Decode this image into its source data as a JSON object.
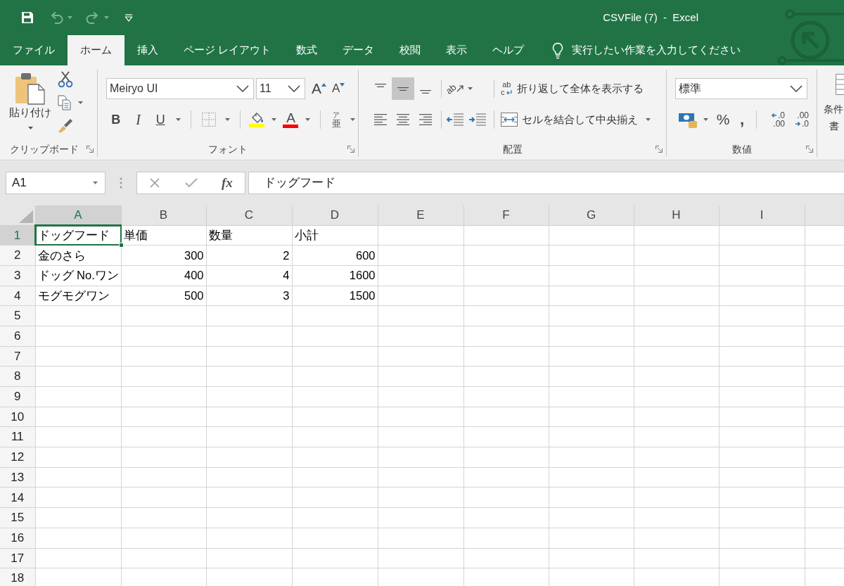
{
  "window": {
    "title": "CSVFile (7)  -  Excel"
  },
  "quick_access": [
    {
      "kind": "save",
      "disabled": false
    },
    {
      "kind": "undo",
      "disabled": true
    },
    {
      "kind": "redo",
      "disabled": true
    },
    {
      "kind": "customize",
      "disabled": false
    }
  ],
  "tabs": [
    {
      "label": "ファイル",
      "selected": false
    },
    {
      "label": "ホーム",
      "selected": true
    },
    {
      "label": "挿入",
      "selected": false
    },
    {
      "label": "ページ レイアウト",
      "selected": false
    },
    {
      "label": "数式",
      "selected": false
    },
    {
      "label": "データ",
      "selected": false
    },
    {
      "label": "校閲",
      "selected": false
    },
    {
      "label": "表示",
      "selected": false
    },
    {
      "label": "ヘルプ",
      "selected": false
    }
  ],
  "tell_me": {
    "placeholder": "実行したい作業を入力してください"
  },
  "ribbon": {
    "clipboard": {
      "label": "クリップボード",
      "paste_label": "貼り付け"
    },
    "font": {
      "label": "フォント",
      "font_name": "Meiryo UI",
      "font_size": "11",
      "grow_glyph": "A",
      "shrink_glyph": "A",
      "styles": [
        {
          "kind": "bold",
          "glyph": "B"
        },
        {
          "kind": "italic",
          "glyph": "I"
        },
        {
          "kind": "underline",
          "glyph": "U"
        }
      ],
      "fill": {
        "color": "#ffff00"
      },
      "font_color": {
        "glyph": "A",
        "color": "#ff0000"
      },
      "phonetic_glyphs": [
        "ア",
        "亜"
      ]
    },
    "alignment": {
      "label": "配置",
      "buttons": [
        {
          "kind": "top",
          "selected": false
        },
        {
          "kind": "middle",
          "selected": true
        },
        {
          "kind": "bottom",
          "selected": false
        },
        {
          "kind": "left",
          "selected": false
        },
        {
          "kind": "center",
          "selected": false
        },
        {
          "kind": "right",
          "selected": false
        }
      ],
      "orientation_glyph": "ab",
      "wrap": {
        "icon_glyphs": [
          "ab",
          "c"
        ],
        "label": "折り返して全体を表示する"
      },
      "merge": {
        "label": "セルを結合して中央揃え"
      }
    },
    "number": {
      "label": "数値",
      "format": "標準",
      "percent_glyph": "%",
      "comma_glyph": ",",
      "decimals": [
        {
          "kind": "increase",
          "lines": [
            ".0",
            ".00"
          ]
        },
        {
          "kind": "decrease",
          "lines": [
            ".00",
            ".0"
          ]
        }
      ]
    },
    "styles": {
      "label_lines": [
        "条件",
        "書"
      ]
    }
  },
  "formula_bar": {
    "name_box": "A1",
    "function_glyph": "fx",
    "formula": "ドッグフード"
  },
  "sheet": {
    "columns": [
      {
        "label": "A",
        "selected": true
      },
      {
        "label": "B",
        "selected": false
      },
      {
        "label": "C",
        "selected": false
      },
      {
        "label": "D",
        "selected": false
      },
      {
        "label": "E",
        "selected": false
      },
      {
        "label": "F",
        "selected": false
      },
      {
        "label": "G",
        "selected": false
      },
      {
        "label": "H",
        "selected": false
      },
      {
        "label": "I",
        "selected": false
      }
    ],
    "rows": [
      {
        "header": "1",
        "selected": true,
        "cells": [
          {
            "kind": "text",
            "text": "ドッグフード",
            "selected": true
          },
          {
            "kind": "text",
            "text": "単価",
            "selected": false
          },
          {
            "kind": "text",
            "text": "数量",
            "selected": false
          },
          {
            "kind": "text",
            "text": "小計",
            "selected": false
          }
        ]
      },
      {
        "header": "2",
        "selected": false,
        "cells": [
          {
            "kind": "text",
            "text": "金のさら",
            "selected": false
          },
          {
            "kind": "number",
            "text": "300",
            "selected": false
          },
          {
            "kind": "number",
            "text": "2",
            "selected": false
          },
          {
            "kind": "number",
            "text": "600",
            "selected": false
          }
        ]
      },
      {
        "header": "3",
        "selected": false,
        "cells": [
          {
            "kind": "text",
            "text": "ドッグ No.ワン",
            "selected": false
          },
          {
            "kind": "number",
            "text": "400",
            "selected": false
          },
          {
            "kind": "number",
            "text": "4",
            "selected": false
          },
          {
            "kind": "number",
            "text": "1600",
            "selected": false
          }
        ]
      },
      {
        "header": "4",
        "selected": false,
        "cells": [
          {
            "kind": "text",
            "text": "モグモグワン",
            "selected": false
          },
          {
            "kind": "number",
            "text": "500",
            "selected": false
          },
          {
            "kind": "number",
            "text": "3",
            "selected": false
          },
          {
            "kind": "number",
            "text": "1500",
            "selected": false
          }
        ]
      },
      {
        "header": "5",
        "selected": false
      },
      {
        "header": "6",
        "selected": false
      },
      {
        "header": "7",
        "selected": false
      },
      {
        "header": "8",
        "selected": false
      },
      {
        "header": "9",
        "selected": false
      },
      {
        "header": "10",
        "selected": false
      },
      {
        "header": "11",
        "selected": false
      },
      {
        "header": "12",
        "selected": false
      },
      {
        "header": "13",
        "selected": false
      },
      {
        "header": "14",
        "selected": false
      },
      {
        "header": "15",
        "selected": false
      },
      {
        "header": "16",
        "selected": false
      },
      {
        "header": "17",
        "selected": false
      },
      {
        "header": "18",
        "selected": false
      }
    ]
  }
}
